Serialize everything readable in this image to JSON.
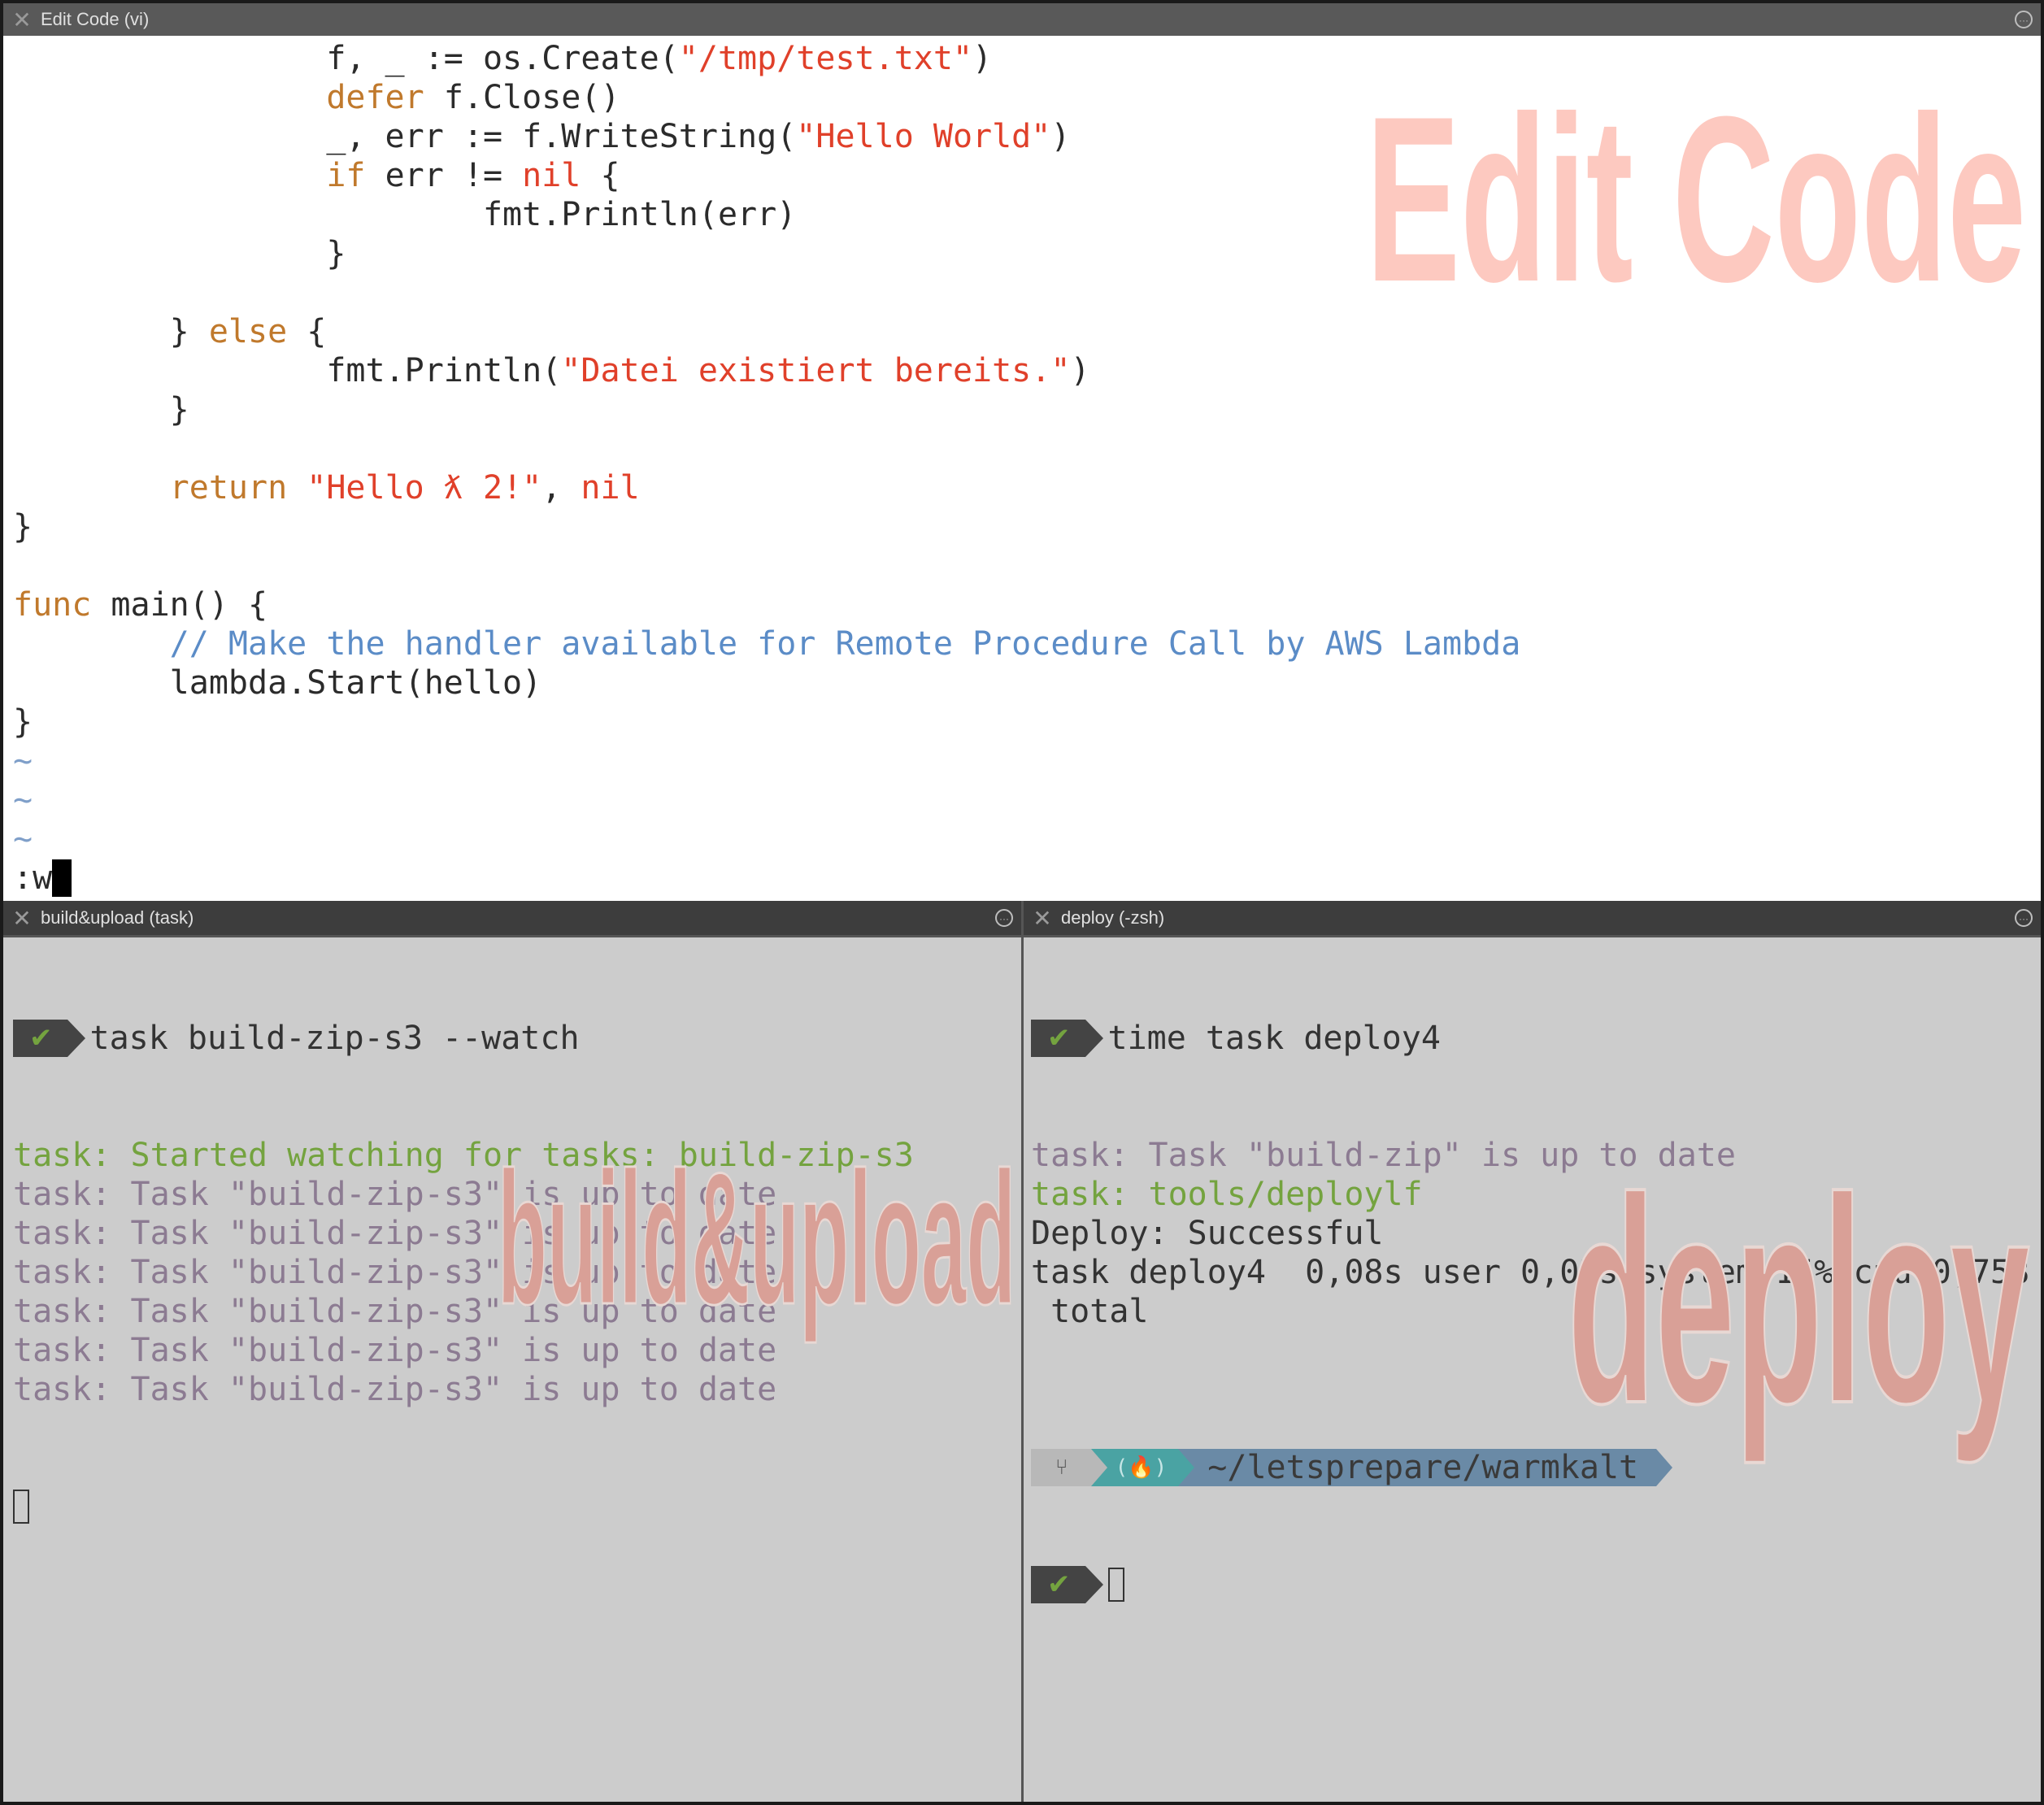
{
  "top_window": {
    "title": "Edit Code (vi)",
    "watermark": "Edit Code"
  },
  "editor": {
    "lines": [
      [
        {
          "t": "                f, _ := os.Create(",
          "c": ""
        },
        {
          "t": "\"/tmp/test.txt\"",
          "c": "str"
        },
        {
          "t": ")",
          "c": ""
        }
      ],
      [
        {
          "t": "                ",
          "c": ""
        },
        {
          "t": "defer",
          "c": "kw"
        },
        {
          "t": " f.Close()",
          "c": ""
        }
      ],
      [
        {
          "t": "                _, err := f.WriteString(",
          "c": ""
        },
        {
          "t": "\"Hello World\"",
          "c": "str"
        },
        {
          "t": ")",
          "c": ""
        }
      ],
      [
        {
          "t": "                ",
          "c": ""
        },
        {
          "t": "if",
          "c": "kw"
        },
        {
          "t": " err != ",
          "c": ""
        },
        {
          "t": "nil",
          "c": "str"
        },
        {
          "t": " {",
          "c": ""
        }
      ],
      [
        {
          "t": "                        fmt.Println(err)",
          "c": ""
        }
      ],
      [
        {
          "t": "                }",
          "c": ""
        }
      ],
      [],
      [
        {
          "t": "        } ",
          "c": ""
        },
        {
          "t": "else",
          "c": "kw"
        },
        {
          "t": " {",
          "c": ""
        }
      ],
      [
        {
          "t": "                fmt.Println(",
          "c": ""
        },
        {
          "t": "\"Datei existiert bereits.\"",
          "c": "str"
        },
        {
          "t": ")",
          "c": ""
        }
      ],
      [
        {
          "t": "        }",
          "c": ""
        }
      ],
      [],
      [
        {
          "t": "        ",
          "c": ""
        },
        {
          "t": "return",
          "c": "kw"
        },
        {
          "t": " ",
          "c": ""
        },
        {
          "t": "\"Hello ƛ 2!\"",
          "c": "str"
        },
        {
          "t": ", ",
          "c": ""
        },
        {
          "t": "nil",
          "c": "str"
        }
      ],
      [
        {
          "t": "}",
          "c": ""
        }
      ],
      [],
      [
        {
          "t": "func",
          "c": "kw"
        },
        {
          "t": " main() {",
          "c": ""
        }
      ],
      [
        {
          "t": "        ",
          "c": ""
        },
        {
          "t": "// Make the handler available for Remote Procedure Call by AWS Lambda",
          "c": "cm"
        }
      ],
      [
        {
          "t": "        lambda.Start(hello)",
          "c": ""
        }
      ],
      [
        {
          "t": "}",
          "c": ""
        }
      ],
      [
        {
          "t": "~",
          "c": "tl"
        }
      ],
      [
        {
          "t": "~",
          "c": "tl"
        }
      ],
      [
        {
          "t": "~",
          "c": "tl"
        }
      ]
    ],
    "command_line": ":w"
  },
  "left_pane": {
    "title": "build&upload (task)",
    "watermark": "build&upload",
    "prompt_command": "task build-zip-s3 --watch",
    "output": [
      {
        "t": "task: Started watching for tasks: build-zip-s3",
        "c": "gr"
      },
      {
        "t": "task: Task \"build-zip-s3\" is up to date",
        "c": "pu"
      },
      {
        "t": "task: Task \"build-zip-s3\" is up to date",
        "c": "pu"
      },
      {
        "t": "task: Task \"build-zip-s3\" is up to date",
        "c": "pu"
      },
      {
        "t": "task: Task \"build-zip-s3\" is up to date",
        "c": "pu"
      },
      {
        "t": "task: Task \"build-zip-s3\" is up to date",
        "c": "pu"
      },
      {
        "t": "task: Task \"build-zip-s3\" is up to date",
        "c": "pu"
      }
    ]
  },
  "right_pane": {
    "title": "deploy (-zsh)",
    "watermark": "deploy",
    "prompt_command": "time task deploy4",
    "output": [
      {
        "t": "task: Task \"build-zip\" is up to date",
        "c": "pu"
      },
      {
        "t": "task: tools/deploylf",
        "c": "gr"
      },
      {
        "t": "Deploy: Successful",
        "c": "dk"
      },
      {
        "t": "task deploy4  0,08s user 0,03s system 15% cpu 0,758",
        "c": "dk"
      },
      {
        "t": " total",
        "c": "dk"
      },
      {
        "t": "",
        "c": "dk"
      }
    ],
    "powerline": {
      "git_icon": "git-branch-icon",
      "firebase_glyph": "(🔥)",
      "path": "~/letsprepare/warmkalt"
    }
  },
  "icons": {
    "close": "✕",
    "more": "···",
    "check": "✔"
  },
  "colors": {
    "keyword": "#c0792c",
    "string": "#e0402a",
    "comment": "#5b8cc7",
    "success": "#74a33f",
    "muted": "#8c7b92",
    "terminal_bg": "#cccccc",
    "watermark": "#fdc9c0"
  }
}
